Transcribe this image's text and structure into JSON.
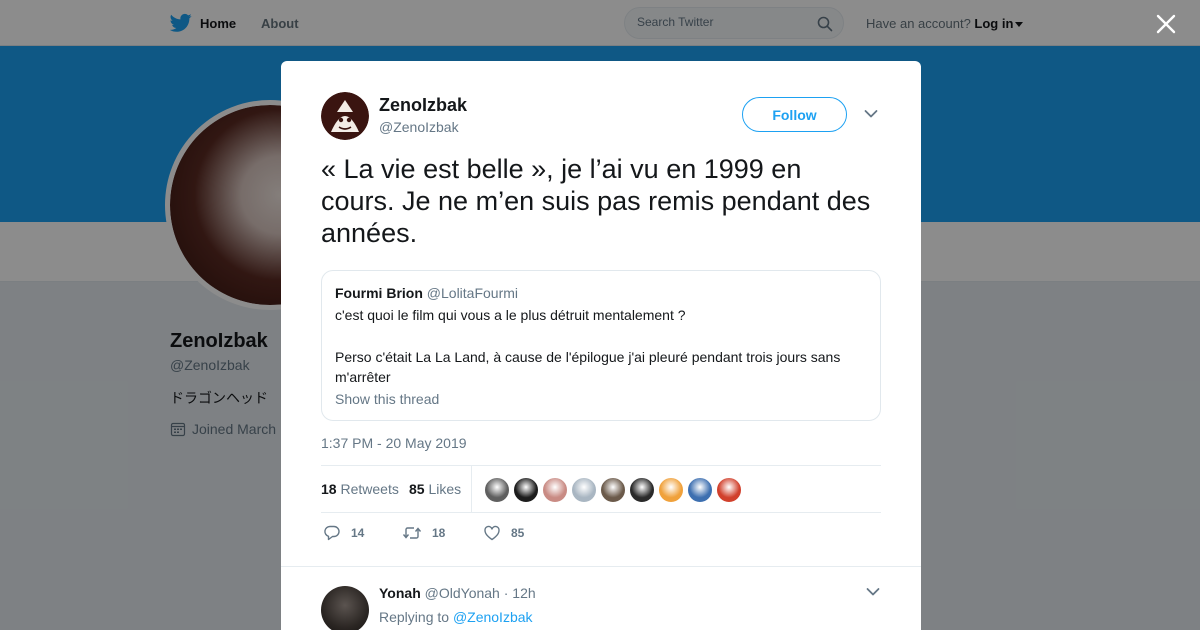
{
  "topbar": {
    "home_label": "Home",
    "about_label": "About",
    "search_placeholder": "Search Twitter",
    "account_prompt": "Have an account?",
    "login_label": "Log in"
  },
  "profile": {
    "name": "ZenoIzbak",
    "handle": "@ZenoIzbak",
    "bio": "ドラゴンヘッド",
    "joined": "Joined March"
  },
  "tweet": {
    "author_name": "ZenoIzbak",
    "author_handle": "@ZenoIzbak",
    "follow_label": "Follow",
    "text": "« La vie est belle », je l’ai vu en 1999 en cours. Je ne m’en suis pas remis pendant des années.",
    "quote": {
      "name": "Fourmi Brion",
      "handle": "@LolitaFourmi",
      "line1": "c'est quoi le film qui vous a le plus détruit mentalement ?",
      "line2": "Perso c'était La La Land, à cause de l'épilogue j'ai pleuré pendant trois jours sans m'arrêter",
      "show_thread": "Show this thread"
    },
    "timestamp": "1:37 PM - 20 May 2019",
    "retweets_count": "18",
    "retweets_label": "Retweets",
    "likes_count": "85",
    "likes_label": "Likes",
    "likers_colors": [
      "#5f5f5f",
      "#1c1c1c",
      "#c98b84",
      "#a9b6c2",
      "#6b5a4a",
      "#2a2a2a",
      "#f0a13b",
      "#3d6fb0",
      "#d1402c"
    ],
    "reply_count": "14",
    "retweet_action_count": "18",
    "like_action_count": "85"
  },
  "reply": {
    "name": "Yonah",
    "handle": "@OldYonah",
    "time": "· 12h",
    "replying_prefix": "Replying to",
    "replying_to": "@ZenoIzbak"
  },
  "colors": {
    "brand": "#1da1f2",
    "muted": "#657786"
  }
}
